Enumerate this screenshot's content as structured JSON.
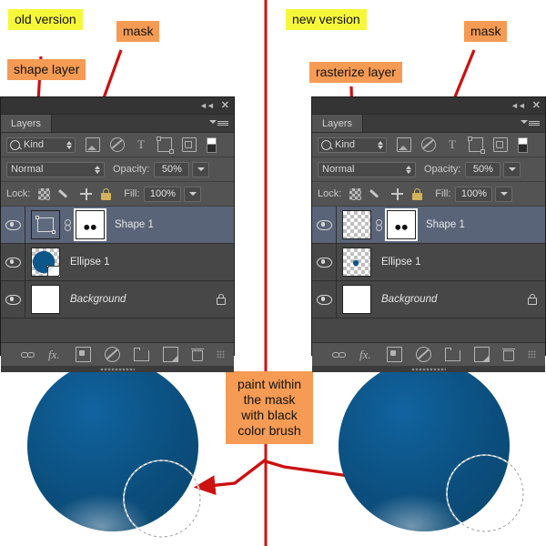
{
  "annotations": {
    "old_version": "old version",
    "new_version": "new version",
    "shape_layer": "shape layer",
    "rasterize_layer": "rasterize layer",
    "mask_left": "mask",
    "mask_right": "mask",
    "paint_note": "paint within\nthe mask\nwith black\ncolor brush",
    "paint_note_lines": [
      "paint within",
      "the mask",
      "with black",
      "color brush"
    ]
  },
  "colors": {
    "callout_yellow": "#f7f739",
    "callout_orange": "#f59b53",
    "arrow_red": "#cc1111",
    "divider_red": "#cc1111",
    "sphere_blue": "#0d5689",
    "panel_bg": "#535353",
    "layer_row_bg": "#474747",
    "layer_row_selected": "#5a6478"
  },
  "panels": [
    {
      "id": "old",
      "title": "Layers",
      "titlebar": {
        "collapse_icon": "collapse-icon",
        "close_icon": "close-icon"
      },
      "filter": {
        "kind_label": "Kind",
        "search_icon": "search-icon",
        "icons": [
          "pixel-filter-icon",
          "adjustment-filter-icon",
          "type-filter-icon",
          "shape-filter-icon",
          "smartobject-filter-icon",
          "filter-toggle-icon"
        ]
      },
      "blend": {
        "mode": "Normal",
        "opacity_label": "Opacity:",
        "opacity_value": "50%",
        "fill_label": "Fill:",
        "fill_value": "100%"
      },
      "lock": {
        "label": "Lock:",
        "icons": [
          "lock-transparent-icon",
          "lock-image-icon",
          "lock-position-icon",
          "lock-all-icon"
        ]
      },
      "layers": [
        {
          "name": "Shape 1",
          "selected": true,
          "visible": true,
          "italic": false,
          "locked": false,
          "thumb": "vector-shape",
          "has_mask": true,
          "linked": true
        },
        {
          "name": "Ellipse 1",
          "selected": false,
          "visible": true,
          "italic": false,
          "locked": false,
          "thumb": "blue-circle-vector",
          "has_mask": false,
          "linked": false
        },
        {
          "name": "Background",
          "selected": false,
          "visible": true,
          "italic": true,
          "locked": true,
          "thumb": "white",
          "has_mask": false,
          "linked": false
        }
      ],
      "bottom_icons": [
        "link-layers-icon",
        "layer-style-fx-icon",
        "add-mask-icon",
        "adjustment-layer-icon",
        "new-group-icon",
        "new-layer-icon",
        "delete-layer-icon"
      ]
    },
    {
      "id": "new",
      "title": "Layers",
      "titlebar": {
        "collapse_icon": "collapse-icon",
        "close_icon": "close-icon"
      },
      "filter": {
        "kind_label": "Kind",
        "search_icon": "search-icon",
        "icons": [
          "pixel-filter-icon",
          "adjustment-filter-icon",
          "type-filter-icon",
          "shape-filter-icon",
          "smartobject-filter-icon",
          "filter-toggle-icon"
        ]
      },
      "blend": {
        "mode": "Normal",
        "opacity_label": "Opacity:",
        "opacity_value": "50%",
        "fill_label": "Fill:",
        "fill_value": "100%"
      },
      "lock": {
        "label": "Lock:",
        "icons": [
          "lock-transparent-icon",
          "lock-image-icon",
          "lock-position-icon",
          "lock-all-icon"
        ]
      },
      "layers": [
        {
          "name": "Shape 1",
          "selected": true,
          "visible": true,
          "italic": false,
          "locked": false,
          "thumb": "transparent",
          "has_mask": true,
          "linked": true
        },
        {
          "name": "Ellipse 1",
          "selected": false,
          "visible": true,
          "italic": false,
          "locked": false,
          "thumb": "transparent-dot",
          "has_mask": false,
          "linked": false
        },
        {
          "name": "Background",
          "selected": false,
          "visible": true,
          "italic": true,
          "locked": true,
          "thumb": "white",
          "has_mask": false,
          "linked": false
        }
      ],
      "bottom_icons": [
        "link-layers-icon",
        "layer-style-fx-icon",
        "add-mask-icon",
        "adjustment-layer-icon",
        "new-group-icon",
        "new-layer-icon",
        "delete-layer-icon"
      ]
    }
  ],
  "canvas": {
    "left_sphere": {
      "label": "blue-sphere-left",
      "brush_cursor": "brush-cursor-circle"
    },
    "right_sphere": {
      "label": "blue-sphere-right",
      "brush_cursor": "brush-cursor-circle"
    }
  }
}
